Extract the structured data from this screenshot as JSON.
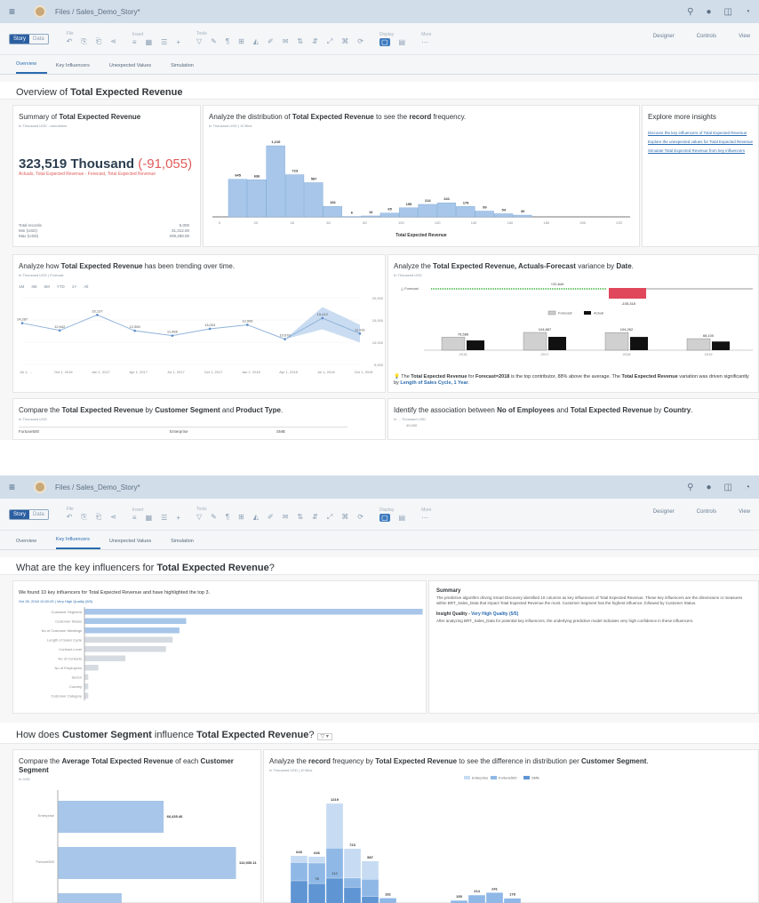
{
  "shell": {
    "breadcrumb": "Files / Sales_Demo_Story*"
  },
  "toolbar": {
    "story_label": "Story",
    "data_label": "Data",
    "file_label": "File",
    "insert_label": "Insert",
    "tools_label": "Tools",
    "display_label": "Display",
    "more_label": "More",
    "designer_label": "Designer",
    "controls_label": "Controls",
    "view_label": "View"
  },
  "tabs": [
    "Overview",
    "Key Influencers",
    "Unexpected Values",
    "Simulation"
  ],
  "s1": {
    "header": {
      "prefix": "Overview of ",
      "bold": "Total Expected Revenue"
    },
    "summary": {
      "title_prefix": "Summary of ",
      "title_bold": "Total Expected Revenue",
      "subtitle": "In Thousand USD - calculation",
      "value": "323,519 Thousand",
      "variance": "(-91,055)",
      "variance_note": "Actuals, Total Expected Revenue - Forecast, Total Expected Revenue",
      "stats": [
        {
          "label": "Total records",
          "value": "5,000"
        },
        {
          "label": "Min (USD)",
          "value": "31,312.00"
        },
        {
          "label": "Max (USD)",
          "value": "209,288.00"
        }
      ]
    },
    "distribution": {
      "title_prefix": "Analyze the distribution of ",
      "title_bold": "Total Expected Revenue",
      "title_mid": " to see the ",
      "title_bold2": "record",
      "title_suffix": " frequency.",
      "subtitle": "In Thousand USD | 10 Bins",
      "chart_data": {
        "type": "bar",
        "categories": [
          "0",
          "10",
          "20",
          "30",
          "40",
          "50",
          "60",
          "70",
          "80",
          "90",
          "100",
          "110",
          "120",
          "130",
          "140",
          "150",
          "160",
          "170",
          "180",
          "190"
        ],
        "values": [
          645,
          636,
          1219,
          723,
          587,
          181,
          6,
          16,
          65,
          155,
          214,
          241,
          178,
          99,
          54,
          30
        ],
        "xticks": [
          "0",
          "20",
          "40",
          "60",
          "80",
          "100",
          "120",
          "140",
          "160",
          "180",
          "200",
          "220"
        ],
        "xlabel": "Total Expected Revenue"
      }
    },
    "explore": {
      "title": "Explore more insights",
      "links": [
        "Discover the key influencers of Total Expected Revenue",
        "Explore the unexpected values for Total Expected Revenue",
        "Simulate Total Expected Revenue from key influencers"
      ]
    },
    "trend": {
      "title_prefix": "Analyze how ",
      "title_bold": "Total Expected Revenue",
      "title_suffix": " has been trending over time.",
      "subtitle": "In Thousand USD | Forecast",
      "ranges": [
        "1M",
        "3M",
        "6M",
        "YTD",
        "1Y",
        "All"
      ],
      "chart_data": {
        "type": "line",
        "x": [
          "Jul 1, ...",
          "Oct 1, 2016",
          "Jan 1, 2017",
          "Apr 1, 2017",
          "Jul 1, 2017",
          "Oct 1, 2017",
          "Jan 1, 2018",
          "Apr 1, 2018",
          "Jul 1, 2018",
          "Oct 1, 2018"
        ],
        "labels": [
          "14,287",
          "12,642",
          "16,137",
          "12,569",
          "11,466",
          "13,003",
          "13,906",
          "10,670",
          "15,412",
          "11,931"
        ],
        "yticks": [
          "20,000",
          "15,000",
          "10,000",
          "5,000"
        ]
      }
    },
    "variance": {
      "title_prefix": "Analyze the ",
      "title_bold": "Total Expected Revenue, Actuals-Forecast",
      "title_mid": " variance by ",
      "title_bold2": "Date",
      "title_suffix": ".",
      "subtitle": "In Thousand USD",
      "forecast_label": "Forecast",
      "positive_label": "+22,644",
      "negative_label": "-105,318",
      "legend": [
        "Forecast",
        "Actual"
      ],
      "chart_data": {
        "type": "bar",
        "categories": [
          "2016",
          "2017",
          "2018",
          "2019"
        ],
        "series": [
          {
            "name": "Forecast",
            "values": [
              76586,
              104887,
              104262,
              68100
            ]
          },
          {
            "name": "Actual",
            "values": [
              76586,
              104887,
              104262,
              68100
            ]
          }
        ],
        "labels": [
          "76,586",
          "104,887",
          "104,262",
          "68,100"
        ]
      },
      "insight_prefix": "The ",
      "insight_b1": "Total Expected Revenue",
      "insight_t1": " for ",
      "insight_b2": "Forecast=2018",
      "insight_t2": " is the top contributor, 88% above the average. The ",
      "insight_b3": "Total Expected Revenue",
      "insight_t3": " variation was driven significantly by ",
      "insight_k": "Length of Sales Cycle, 1 Year",
      "insight_end": "."
    },
    "compare": {
      "title_prefix": "Compare the ",
      "title_bold": "Total Expected Revenue",
      "title_mid": " by ",
      "title_bold2": "Customer Segment",
      "title_mid2": " and ",
      "title_bold3": "Product Type",
      "title_suffix": ".",
      "subtitle": "In Thousand USD",
      "columns": [
        "Fortune500",
        "Enterprise",
        "SMB"
      ]
    },
    "assoc": {
      "title_prefix": "Identify the association between ",
      "title_bold": "No of Employees",
      "title_mid": " and ",
      "title_bold2": "Total Expected Revenue",
      "title_mid2": " by ",
      "title_bold3": "Country",
      "title_suffix": ".",
      "subtitle": "In ... Thousand USD",
      "ytick": "40,000"
    }
  },
  "s2": {
    "header": {
      "prefix": "What are the key influencers for ",
      "bold": "Total Expected Revenue",
      "suffix": "?"
    },
    "ki": {
      "title": "We found 10 key influencers for Total Expected Revenue and have highlighted the top 3.",
      "subtitle": "Oct 26, 2018 10:00:26 | Very High Quality (5/5)",
      "chart_data": {
        "type": "bar",
        "categories": [
          "Customer Segment",
          "Customer Status",
          "No of Customer Meetings",
          "Length of Sales Cycle",
          "Contract Level",
          "No of Contacts",
          "No of Employees",
          "Sector",
          "Country",
          "Customer Category"
        ],
        "values": [
          100,
          30,
          28,
          26,
          24,
          12,
          4,
          1,
          1,
          1
        ]
      }
    },
    "summary": {
      "title": "Summary",
      "text": "The predictive algorithm driving Smart Discovery identified 10 columns as key influencers of Total Expected Revenue. These key influencers are the dimensions or measures within BRT_Sales_Data that impact Total Expected Revenue the most. Customer Segment has the highest influence, followed by Customer Status.",
      "quality_prefix": "Insight Quality - ",
      "quality_link": "Very High Quality (5/5)",
      "quality_text": "After analyzing BRT_Sales_Data for potential key influencers, the underlying predictive model indicates very high confidence in these influencers."
    },
    "influence": {
      "prefix": "How does ",
      "bold": "Customer Segment",
      "mid": " influence ",
      "bold2": "Total Expected Revenue",
      "suffix": "?"
    },
    "avg": {
      "title_prefix": "Compare the ",
      "title_bold": "Average Total Expected Revenue",
      "title_mid": " of each ",
      "title_bold2": "Customer Segment",
      "subtitle": "In USD",
      "chart_data": {
        "type": "bar",
        "categories": [
          "Enterprise",
          "Fortune500",
          "SMB"
        ],
        "values": [
          66435.46,
          112030.11,
          40000
        ],
        "labels": [
          "66,435.46",
          "112,030.11",
          ""
        ]
      }
    },
    "freq": {
      "title_prefix": "Analyze the ",
      "title_bold": "record",
      "title_mid": " frequency by ",
      "title_bold2": "Total Expected Revenue",
      "title_mid2": " to see the difference in distribution per ",
      "title_bold3": "Customer Segment",
      "title_suffix": ".",
      "subtitle": "In Thousand USD | 10 Bins",
      "legend": [
        "Enterprise",
        "Fortune500",
        "SMB"
      ],
      "chart_data": {
        "type": "bar",
        "categories": [
          "b1",
          "b2",
          "b3",
          "b4",
          "b5",
          "b6",
          "b7",
          "b8",
          "b9",
          "b10",
          "b11",
          "b12",
          "b13",
          "b14"
        ],
        "totals": [
          645,
          636,
          1219,
          723,
          587,
          181,
          0,
          0,
          0,
          155,
          214,
          241,
          178,
          0
        ],
        "series": [
          {
            "name": "SMB",
            "values": [
              371,
              341,
              400,
              300,
              200,
              0,
              0,
              0,
              0,
              0,
              0,
              0,
              0,
              0
            ]
          },
          {
            "name": "Fortune500",
            "values": [
              200,
              225,
              330,
              101,
              187,
              181,
              0,
              0,
              0,
              155,
              214,
              241,
              178,
              0
            ]
          },
          {
            "name": "Enterprise",
            "values": [
              74,
              70,
              489,
              322,
              200,
              0,
              0,
              0,
              0,
              0,
              0,
              0,
              0,
              0
            ]
          }
        ],
        "mid_labels": [
          "",
          "78",
          "112",
          "",
          "",
          "",
          "",
          "",
          "",
          "",
          "",
          "",
          "",
          ""
        ],
        "seg_labels": [
          "371",
          "341",
          "577",
          "321",
          "",
          "",
          "",
          "",
          "",
          "",
          "",
          "",
          "",
          ""
        ]
      }
    }
  },
  "colors": {
    "bar": "#a7c6e9",
    "bar_stroke": "#7aa6d8",
    "neg": "#e0475b",
    "pos": "#5ec05e",
    "link": "#2b6cb0"
  }
}
